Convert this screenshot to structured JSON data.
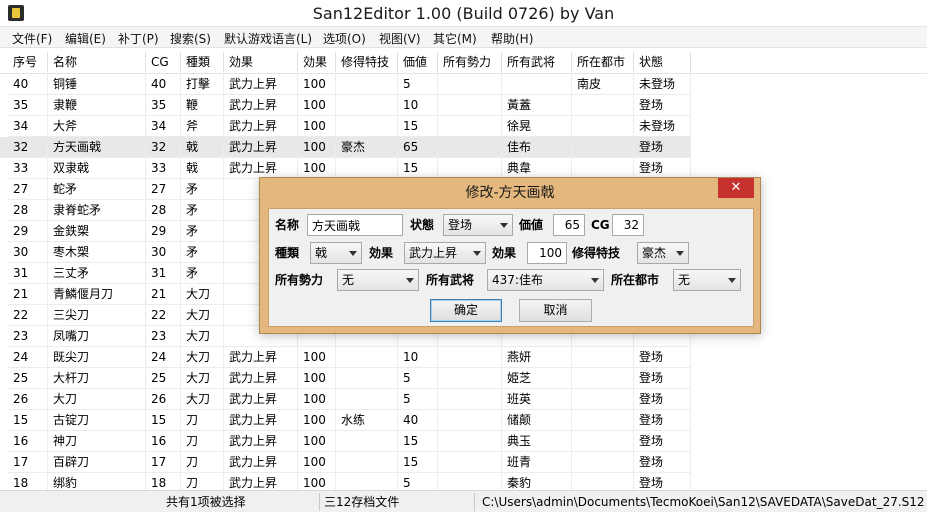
{
  "window": {
    "title": "San12Editor 1.00 (Build 0726) by Van"
  },
  "menu": [
    "文件(F)",
    "编辑(E)",
    "补丁(P)",
    "搜索(S)",
    "默认游戏语言(L)",
    "选项(O)",
    "视图(V)",
    "其它(M)",
    "帮助(H)"
  ],
  "table": {
    "headers": [
      "序号",
      "名称",
      "CG",
      "種類",
      "効果",
      "効果",
      "修得特技",
      "価値",
      "所有勢力",
      "所有武将",
      "所在都市",
      "状態"
    ],
    "rows": [
      [
        "40",
        "铜锤",
        "40",
        "打擊",
        "武力上昇",
        "100",
        "",
        "5",
        "",
        "",
        "南皮",
        "未登场"
      ],
      [
        "35",
        "隶鞭",
        "35",
        "鞭",
        "武力上昇",
        "100",
        "",
        "10",
        "",
        "黃蓋",
        "",
        "登场"
      ],
      [
        "34",
        "大斧",
        "34",
        "斧",
        "武力上昇",
        "100",
        "",
        "15",
        "",
        "徐晃",
        "",
        "未登场"
      ],
      [
        "32",
        "方天画戟",
        "32",
        "戟",
        "武力上昇",
        "100",
        "豪杰",
        "65",
        "",
        "佳布",
        "",
        "登场"
      ],
      [
        "33",
        "双隶戟",
        "33",
        "戟",
        "武力上昇",
        "100",
        "",
        "15",
        "",
        "典韋",
        "",
        "登场"
      ],
      [
        "27",
        "蛇矛",
        "27",
        "矛",
        "",
        "",
        "",
        "",
        "",
        "",
        "",
        ""
      ],
      [
        "28",
        "隶脊蛇矛",
        "28",
        "矛",
        "",
        "",
        "",
        "",
        "",
        "",
        "",
        ""
      ],
      [
        "29",
        "金鉄槊",
        "29",
        "矛",
        "",
        "",
        "",
        "",
        "",
        "",
        "",
        ""
      ],
      [
        "30",
        "枣木槊",
        "30",
        "矛",
        "",
        "",
        "",
        "",
        "",
        "",
        "",
        ""
      ],
      [
        "31",
        "三丈矛",
        "31",
        "矛",
        "",
        "",
        "",
        "",
        "",
        "",
        "",
        ""
      ],
      [
        "21",
        "青鱗偃月刀",
        "21",
        "大刀",
        "",
        "",
        "",
        "",
        "",
        "",
        "",
        ""
      ],
      [
        "22",
        "三尖刀",
        "22",
        "大刀",
        "",
        "",
        "",
        "",
        "",
        "",
        "",
        ""
      ],
      [
        "23",
        "凤嘴刀",
        "23",
        "大刀",
        "",
        "",
        "",
        "",
        "",
        "",
        "",
        ""
      ],
      [
        "24",
        "既尖刀",
        "24",
        "大刀",
        "武力上昇",
        "100",
        "",
        "10",
        "",
        "燕妍",
        "",
        "登场"
      ],
      [
        "25",
        "大杆刀",
        "25",
        "大刀",
        "武力上昇",
        "100",
        "",
        "5",
        "",
        "姫芝",
        "",
        "登场"
      ],
      [
        "26",
        "大刀",
        "26",
        "大刀",
        "武力上昇",
        "100",
        "",
        "5",
        "",
        "班英",
        "",
        "登场"
      ],
      [
        "15",
        "古锭刀",
        "15",
        "刀",
        "武力上昇",
        "100",
        "水练",
        "40",
        "",
        "储颠",
        "",
        "登场"
      ],
      [
        "16",
        "神刀",
        "16",
        "刀",
        "武力上昇",
        "100",
        "",
        "15",
        "",
        "典玉",
        "",
        "登场"
      ],
      [
        "17",
        "百辟刀",
        "17",
        "刀",
        "武力上昇",
        "100",
        "",
        "15",
        "",
        "班青",
        "",
        "登场"
      ],
      [
        "18",
        "绑豹",
        "18",
        "刀",
        "武力上昇",
        "100",
        "",
        "5",
        "",
        "秦豹",
        "",
        "登场"
      ]
    ]
  },
  "dialog": {
    "title": "修改-方天画戟",
    "close": "✕",
    "name_label": "名称",
    "name_value": "方天画戟",
    "state_label": "状態",
    "state_value": "登场",
    "value_label": "価値",
    "value_value": "65",
    "cg_label": "CG",
    "cg_value": "32",
    "type_label": "種類",
    "type_value": "戟",
    "effect_label": "効果",
    "effect_value": "武力上昇",
    "effect2_label": "効果",
    "effect2_value": "100",
    "skill_label": "修得特技",
    "skill_value": "豪杰",
    "force_label": "所有勢力",
    "force_value": "无",
    "officer_label": "所有武将",
    "officer_value": "437:佳布",
    "city_label": "所在都市",
    "city_value": "无",
    "ok": "确定",
    "cancel": "取消"
  },
  "status": {
    "selection": "共有1项被选择",
    "filetype": "三12存档文件",
    "path": "C:\\Users\\admin\\Documents\\TecmoKoei\\San12\\SAVEDATA\\SaveDat_27.S12"
  }
}
